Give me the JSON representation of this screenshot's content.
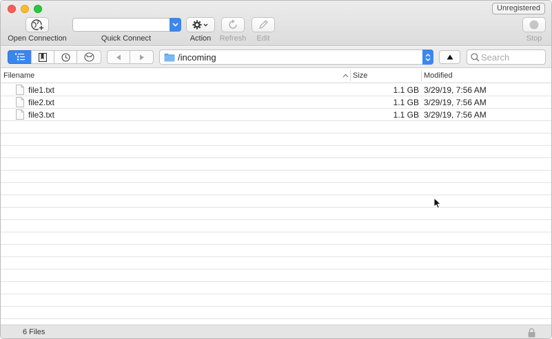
{
  "window": {
    "badge": "Unregistered"
  },
  "toolbar": {
    "open_connection": "Open Connection",
    "quick_connect": "Quick Connect",
    "quick_connect_value": "",
    "action": "Action",
    "refresh": "Refresh",
    "edit": "Edit",
    "stop": "Stop"
  },
  "nav": {
    "path": "/incoming",
    "search_placeholder": "Search",
    "icons": [
      "outline-view-icon",
      "bookmarks-icon",
      "history-icon",
      "bonjour-icon",
      "back-icon",
      "forward-icon",
      "folder-icon",
      "up-icon"
    ]
  },
  "table": {
    "columns": {
      "filename": "Filename",
      "size": "Size",
      "modified": "Modified"
    },
    "rows": [
      {
        "name": "file1.txt",
        "size": "1.1 GB",
        "modified": "3/29/19, 7:56 AM"
      },
      {
        "name": "file2.txt",
        "size": "1.1 GB",
        "modified": "3/29/19, 7:56 AM"
      },
      {
        "name": "file3.txt",
        "size": "1.1 GB",
        "modified": "3/29/19, 7:56 AM"
      }
    ]
  },
  "status": {
    "count": "6 Files"
  },
  "colors": {
    "accent": "#3a86ef",
    "close": "#fc5f57",
    "minimize": "#fdbc2e",
    "maximize": "#29c840"
  }
}
